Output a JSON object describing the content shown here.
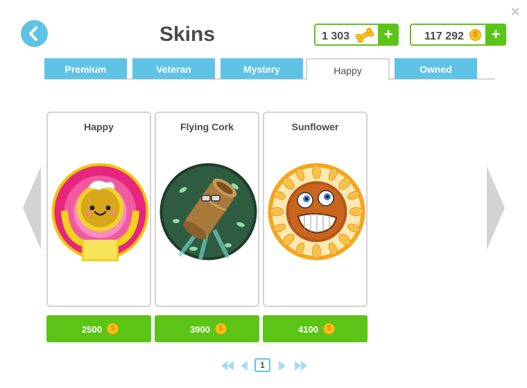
{
  "header": {
    "title": "Skins",
    "close_label": "×",
    "back_label": "back"
  },
  "currencies": {
    "bones": {
      "amount": "1 303",
      "plus_label": "+",
      "icon": "bone-icon"
    },
    "coins": {
      "amount": "117 292",
      "plus_label": "+",
      "icon": "coin-icon",
      "coin_symbol": "$"
    }
  },
  "tabs": [
    {
      "label": "Premium",
      "active": false
    },
    {
      "label": "Veteran",
      "active": false
    },
    {
      "label": "Mystery",
      "active": false
    },
    {
      "label": "Happy",
      "active": true
    },
    {
      "label": "Owned",
      "active": false
    }
  ],
  "skins": [
    {
      "name": "Happy",
      "price": "2500",
      "art": "happy-skin-art"
    },
    {
      "name": "Flying Cork",
      "price": "3900",
      "art": "flying-cork-skin-art"
    },
    {
      "name": "Sunflower",
      "price": "4100",
      "art": "sunflower-skin-art"
    }
  ],
  "pagination": {
    "current_page": "1"
  },
  "colors": {
    "accent_blue": "#5fc3e6",
    "buy_green": "#5cc417",
    "title_text": "#4a4a4a",
    "coin_gold": "#f7c21a"
  }
}
